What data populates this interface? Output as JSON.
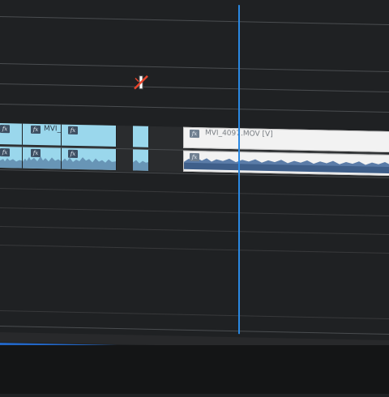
{
  "timeline": {
    "video_clips": [
      {
        "label": "",
        "fx": "fx"
      },
      {
        "label": "MVI_",
        "fx": "fx"
      },
      {
        "label": "",
        "fx": "fx"
      },
      {
        "label": "MVI_4097.MOV [V]",
        "fx": "fx"
      }
    ],
    "audio_clips": [
      {
        "fx": "fx"
      },
      {
        "fx": "fx"
      },
      {
        "fx": "fx"
      },
      {
        "fx": "fx"
      }
    ]
  },
  "colors": {
    "clip_blue": "#9ad7ec",
    "clip_white": "#f2f2f2",
    "playhead": "#2a88e2",
    "waveform": "#3f5f8a"
  },
  "icons": {
    "cursor": "razor-no-edit-cursor-icon"
  }
}
